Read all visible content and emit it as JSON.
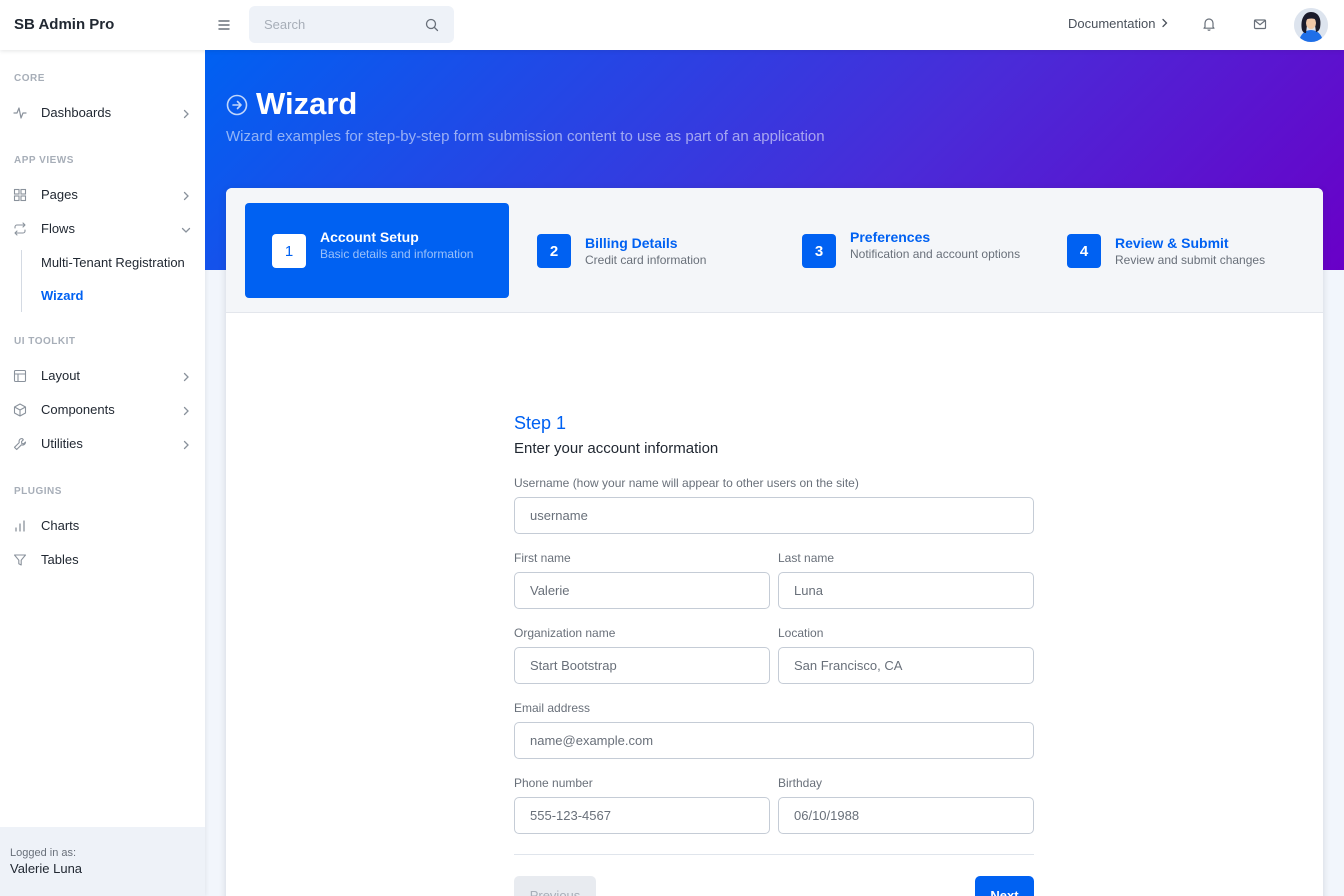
{
  "brand": "SB Admin Pro",
  "search": {
    "placeholder": "Search"
  },
  "topnav": {
    "docs_label": "Documentation"
  },
  "sidebar": {
    "sections": [
      "CORE",
      "APP VIEWS",
      "UI TOOLKIT",
      "PLUGINS"
    ],
    "items": {
      "dashboards": "Dashboards",
      "pages": "Pages",
      "flows": "Flows",
      "multi_tenant": "Multi-Tenant Registration",
      "wizard": "Wizard",
      "layout": "Layout",
      "components": "Components",
      "utilities": "Utilities",
      "charts": "Charts",
      "tables": "Tables"
    },
    "footer": {
      "caption": "Logged in as:",
      "name": "Valerie Luna"
    }
  },
  "header": {
    "title": "Wizard",
    "subtitle": "Wizard examples for step-by-step form submission content to use as part of an application"
  },
  "steps": [
    {
      "number": "1",
      "title": "Account Setup",
      "subtitle": "Basic details and information",
      "active": true
    },
    {
      "number": "2",
      "title": "Billing Details",
      "subtitle": "Credit card information",
      "active": false
    },
    {
      "number": "3",
      "title": "Preferences",
      "subtitle": "Notification and account options",
      "active": false
    },
    {
      "number": "4",
      "title": "Review & Submit",
      "subtitle": "Review and submit changes",
      "active": false
    }
  ],
  "form": {
    "step_label": "Step 1",
    "heading": "Enter your account information",
    "username": {
      "label": "Username (how your name will appear to other users on the site)",
      "placeholder": "username"
    },
    "first_name": {
      "label": "First name",
      "value": "Valerie"
    },
    "last_name": {
      "label": "Last name",
      "value": "Luna"
    },
    "organization": {
      "label": "Organization name",
      "value": "Start Bootstrap"
    },
    "location": {
      "label": "Location",
      "value": "San Francisco, CA"
    },
    "email": {
      "label": "Email address",
      "placeholder": "name@example.com"
    },
    "phone": {
      "label": "Phone number",
      "value": "555-123-4567"
    },
    "birthday": {
      "label": "Birthday",
      "value": "06/10/1988"
    },
    "prev_label": "Previous",
    "next_label": "Next"
  },
  "colors": {
    "primary": "#0061f2",
    "gradient_end": "#6900c7"
  }
}
